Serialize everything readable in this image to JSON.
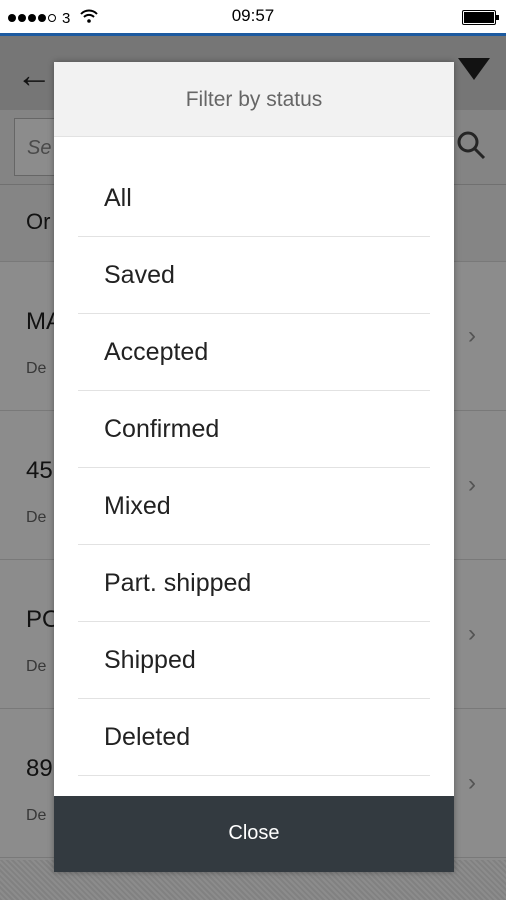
{
  "statusbar": {
    "carrier": "3",
    "time": "09:57"
  },
  "background": {
    "search_placeholder": "Se",
    "sort_label": "Or",
    "items": [
      {
        "title": "MA",
        "sub": "De"
      },
      {
        "title": "45",
        "sub": "De"
      },
      {
        "title": "PO",
        "sub": "De"
      },
      {
        "title": "89",
        "sub": "De"
      }
    ]
  },
  "dialog": {
    "title": "Filter by status",
    "options": [
      "All",
      "Saved",
      "Accepted",
      "Confirmed",
      "Mixed",
      "Part. shipped",
      "Shipped",
      "Deleted"
    ],
    "close_label": "Close"
  },
  "colors": {
    "accent": "#1c5aa0",
    "close_bg": "#333a40"
  },
  "icons": [
    "back-arrow-icon",
    "filter-icon",
    "search-icon",
    "chevron-right-icon",
    "wifi-icon",
    "battery-icon"
  ]
}
